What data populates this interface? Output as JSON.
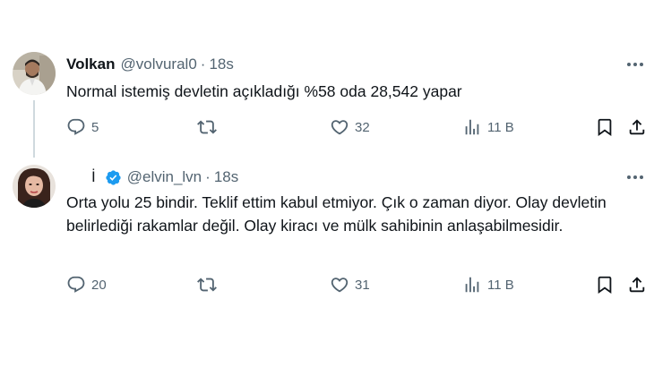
{
  "tweets": [
    {
      "name": "Volkan",
      "handle": "@volvural0",
      "time": "18s",
      "text": "Normal istemiş devletin açıkladığı %58 oda 28,542 yapar",
      "replies": "5",
      "retweets": "",
      "likes": "32",
      "views": "11 B",
      "avatar_icon": "user-photo-man"
    },
    {
      "name": "İ",
      "handle": "@elvin_lvn",
      "time": "18s",
      "text": "Orta yolu 25 bindir. Teklif ettim kabul etmiyor. Çık o zaman diyor. Olay devletin belirlediği rakamlar değil. Olay kiracı ve mülk sahibinin anlaşabilmesidir.",
      "replies": "20",
      "retweets": "",
      "likes": "31",
      "views": "11 B",
      "verified": true,
      "avatar_icon": "user-photo-woman"
    }
  ],
  "separator": "·",
  "colors": {
    "text": "#0f1419",
    "secondary": "#536471",
    "verified": "#1d9bf0",
    "thread_line": "#cfd9de"
  }
}
